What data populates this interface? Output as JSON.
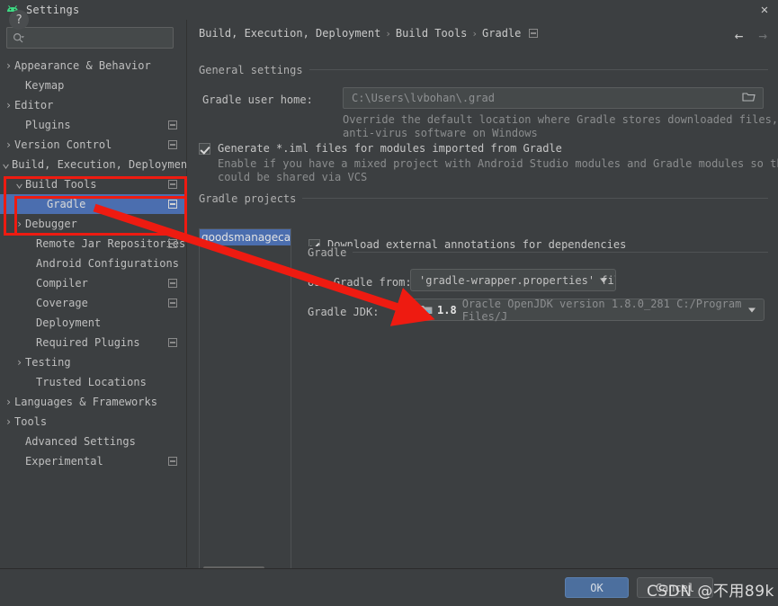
{
  "window": {
    "title": "Settings",
    "app_icon": "android-studio-icon",
    "close_icon": "close-icon"
  },
  "sidebar": {
    "search": {
      "placeholder": "",
      "value": "",
      "icon": "search-icon"
    },
    "items": [
      {
        "label": "Appearance & Behavior",
        "indent": 0,
        "arrow": "collapsed",
        "badge": false,
        "selected": false
      },
      {
        "label": "Keymap",
        "indent": 1,
        "arrow": "none",
        "badge": false,
        "selected": false
      },
      {
        "label": "Editor",
        "indent": 0,
        "arrow": "collapsed",
        "badge": false,
        "selected": false
      },
      {
        "label": "Plugins",
        "indent": 1,
        "arrow": "none",
        "badge": true,
        "selected": false
      },
      {
        "label": "Version Control",
        "indent": 0,
        "arrow": "collapsed",
        "badge": true,
        "selected": false
      },
      {
        "label": "Build, Execution, Deployment",
        "indent": 0,
        "arrow": "expanded",
        "badge": false,
        "selected": false
      },
      {
        "label": "Build Tools",
        "indent": 1,
        "arrow": "expanded",
        "badge": true,
        "selected": false
      },
      {
        "label": "Gradle",
        "indent": 3,
        "arrow": "none",
        "badge": true,
        "selected": true
      },
      {
        "label": "Debugger",
        "indent": 1,
        "arrow": "collapsed",
        "badge": false,
        "selected": false
      },
      {
        "label": "Remote Jar Repositories",
        "indent": 2,
        "arrow": "none",
        "badge": true,
        "selected": false
      },
      {
        "label": "Android Configurations",
        "indent": 2,
        "arrow": "none",
        "badge": false,
        "selected": false
      },
      {
        "label": "Compiler",
        "indent": 2,
        "arrow": "none",
        "badge": true,
        "selected": false
      },
      {
        "label": "Coverage",
        "indent": 2,
        "arrow": "none",
        "badge": true,
        "selected": false
      },
      {
        "label": "Deployment",
        "indent": 2,
        "arrow": "none",
        "badge": false,
        "selected": false
      },
      {
        "label": "Required Plugins",
        "indent": 2,
        "arrow": "none",
        "badge": true,
        "selected": false
      },
      {
        "label": "Testing",
        "indent": 1,
        "arrow": "collapsed",
        "badge": false,
        "selected": false
      },
      {
        "label": "Trusted Locations",
        "indent": 2,
        "arrow": "none",
        "badge": false,
        "selected": false
      },
      {
        "label": "Languages & Frameworks",
        "indent": 0,
        "arrow": "collapsed",
        "badge": false,
        "selected": false
      },
      {
        "label": "Tools",
        "indent": 0,
        "arrow": "collapsed",
        "badge": false,
        "selected": false
      },
      {
        "label": "Advanced Settings",
        "indent": 1,
        "arrow": "none",
        "badge": false,
        "selected": false
      },
      {
        "label": "Experimental",
        "indent": 1,
        "arrow": "none",
        "badge": true,
        "selected": false
      }
    ]
  },
  "breadcrumb": {
    "parts": [
      "Build, Execution, Deployment",
      "Build Tools",
      "Gradle"
    ],
    "separator": "›",
    "badge_icon": "modified-badge-icon"
  },
  "nav": {
    "back_icon": "arrow-left-icon",
    "forward_icon": "arrow-right-icon"
  },
  "general": {
    "section_label": "General settings",
    "gradle_user_home_label": "Gradle user home:",
    "gradle_user_home_value": "C:\\Users\\lvbohan\\.grad",
    "browse_icon": "folder-icon",
    "hint_line1": "Override the default location where Gradle stores downloaded files, e.g. to tune",
    "hint_line2": "anti-virus software on Windows",
    "generate_iml_label": "Generate *.iml files for modules imported from Gradle",
    "generate_iml_checked": true,
    "generate_iml_hint1": "Enable if you have a mixed project with Android Studio modules and Gradle modules so that it",
    "generate_iml_hint2": "could be shared via VCS"
  },
  "projects": {
    "section_label": "Gradle projects",
    "items": [
      "goodsmanagecabin"
    ],
    "download_annotations_label": "Download external annotations for dependencies",
    "download_annotations_checked": true
  },
  "gradle": {
    "section_label": "Gradle",
    "use_gradle_from_label": "Use Gradle from:",
    "use_gradle_from_value": "'gradle-wrapper.properties' file",
    "jdk_label": "Gradle JDK:",
    "jdk_icon": "java-folder-icon",
    "jdk_version": "1.8",
    "jdk_description": "Oracle OpenJDK version 1.8.0_281 C:/Program Files/J"
  },
  "footer": {
    "help_label": "?",
    "ok_label": "OK",
    "cancel_label": "Cancel"
  },
  "watermark": {
    "text": "CSDN @不用89k"
  },
  "colors": {
    "background": "#3c3f41",
    "selection": "#4b6eaf",
    "annotation_red": "#ee1b11",
    "ok_button": "#4c6f9e"
  }
}
